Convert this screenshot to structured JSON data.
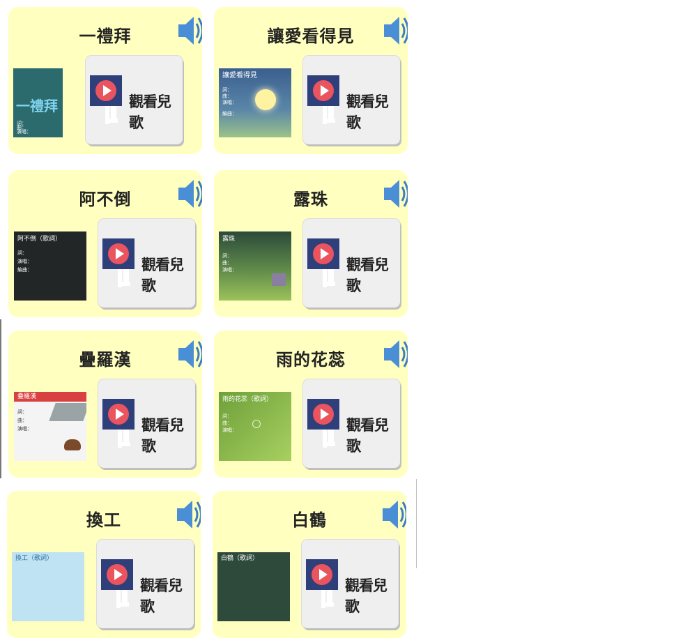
{
  "watch_label": "觀看兒歌",
  "cards": [
    {
      "title": "一禮拜",
      "thumb_title": "一禮拜",
      "thumb_lines": [
        "詞：",
        "曲：",
        "演唱："
      ]
    },
    {
      "title": "讓愛看得見",
      "thumb_title": "讓愛看得見",
      "thumb_lines": [
        "詞：",
        "曲：",
        "演唱：",
        "編曲："
      ]
    },
    {
      "title": "阿不倒",
      "thumb_title": "阿不倒（歌詞）",
      "thumb_lines": [
        "詞：",
        "演唱：",
        "編曲："
      ]
    },
    {
      "title": "露珠",
      "thumb_title": "露珠",
      "thumb_lines": [
        "詞：",
        "曲：",
        "演唱："
      ]
    },
    {
      "title": "疊羅漢",
      "thumb_title": "疊羅漢",
      "thumb_lines": [
        "詞：",
        "曲：",
        "演唱："
      ]
    },
    {
      "title": "雨的花蕊",
      "thumb_title": "雨的花蕊（歌詞）",
      "thumb_lines": [
        "詞：",
        "曲：",
        "演唱："
      ]
    },
    {
      "title": "換工",
      "thumb_title": "換工（歌詞）",
      "thumb_lines": []
    },
    {
      "title": "白鶴",
      "thumb_title": "白鶴（歌詞）",
      "thumb_lines": []
    }
  ]
}
